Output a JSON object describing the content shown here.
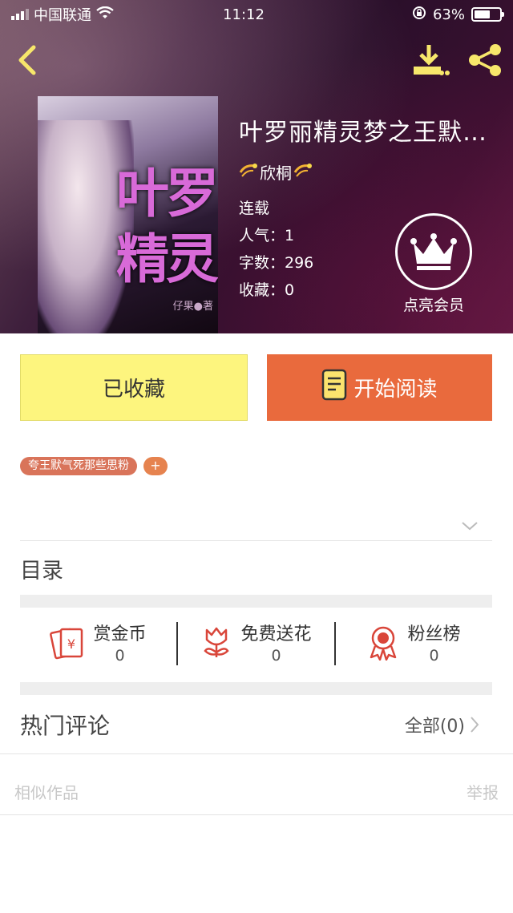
{
  "status_bar": {
    "carrier": "中国联通",
    "time": "11:12",
    "battery": "63%",
    "battery_level": 0.63
  },
  "book": {
    "title": "叶罗丽精灵梦之王默…",
    "author": "欣桐",
    "status": "连载",
    "popularity": "人气：1",
    "word_count": "字数：296",
    "favorites": "收藏：0",
    "cover_title_line1": "叶罗",
    "cover_title_line2": "精灵",
    "cover_author": "仔果●著"
  },
  "vip": {
    "label": "点亮会员"
  },
  "actions": {
    "favorited_label": "已收藏",
    "read_label": "开始阅读"
  },
  "tags": [
    "夸王默气死那些思粉"
  ],
  "tag_add": "+",
  "toc": {
    "label": "目录"
  },
  "stats": [
    {
      "label": "赏金币",
      "value": "0",
      "icon": "red-envelope-icon"
    },
    {
      "label": "免费送花",
      "value": "0",
      "icon": "flower-icon"
    },
    {
      "label": "粉丝榜",
      "value": "0",
      "icon": "medal-icon"
    }
  ],
  "comments": {
    "title": "热门评论",
    "all_label": "全部(0)"
  },
  "footer": {
    "similar": "相似作品",
    "report": "举报"
  },
  "colors": {
    "fav_bg": "#fdf57e",
    "read_bg": "#e96a3d",
    "tag_bg": "#d9745a",
    "icon_red": "#d9463a"
  }
}
